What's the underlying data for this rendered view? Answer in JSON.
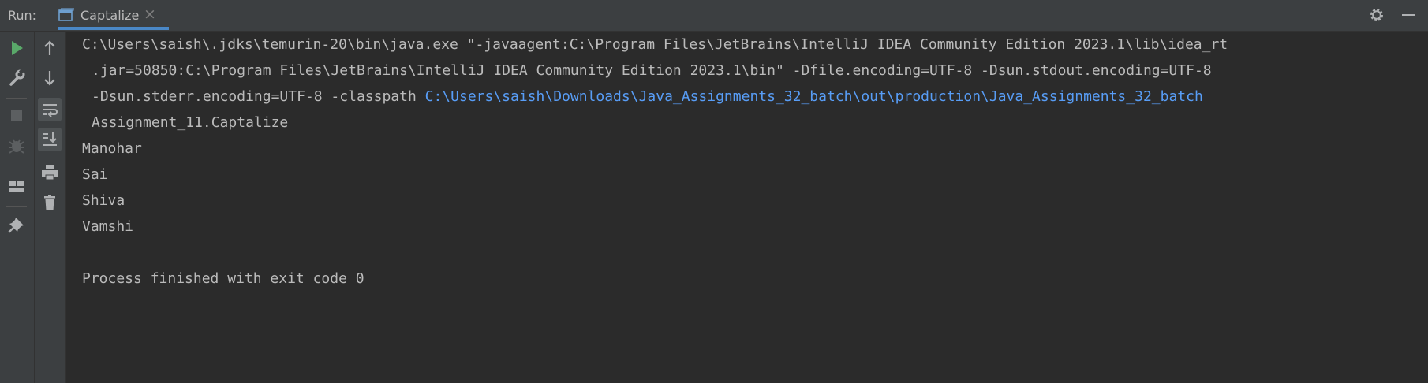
{
  "header": {
    "run_label": "Run:",
    "tab_title": "Captalize",
    "tab_close": "×",
    "icons": [
      "run-config-icon",
      "settings-gear-icon",
      "minimize-icon"
    ]
  },
  "toolbar_left": {
    "icons": [
      "rerun-icon",
      "edit-config-wrench-icon",
      "stop-icon",
      "debug-disabled-icon",
      "layout-icon",
      "pin-icon"
    ]
  },
  "toolbar_right": {
    "icons": [
      "scroll-up-arrow-icon",
      "scroll-down-arrow-icon",
      "soft-wrap-icon",
      "scroll-to-end-icon",
      "print-icon",
      "clear-trash-icon"
    ]
  },
  "console": {
    "line1": "C:\\Users\\saish\\.jdks\\temurin-20\\bin\\java.exe \"-javaagent:C:\\Program Files\\JetBrains\\IntelliJ IDEA Community Edition 2023.1\\lib\\idea_rt",
    "line2": ".jar=50850:C:\\Program Files\\JetBrains\\IntelliJ IDEA Community Edition 2023.1\\bin\" -Dfile.encoding=UTF-8 -Dsun.stdout.encoding=UTF-8",
    "line3_prefix": "-Dsun.stderr.encoding=UTF-8 -classpath ",
    "line3_link": "C:\\Users\\saish\\Downloads\\Java_Assignments_32_batch\\out\\production\\Java_Assignments_32_batch",
    "line4": "Assignment_11.Captalize",
    "outputs": [
      "Manohar",
      "Sai",
      "Shiva",
      "Vamshi"
    ],
    "exit_message": "Process finished with exit code 0"
  },
  "colors": {
    "background": "#2b2b2b",
    "panel": "#3c3f41",
    "text": "#bbbbbb",
    "link": "#589df6",
    "run_green": "#59a869"
  }
}
